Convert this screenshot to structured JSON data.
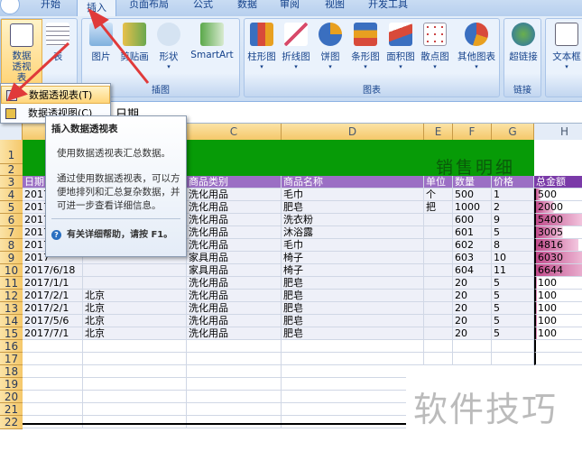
{
  "tabs": [
    "开始",
    "插入",
    "页面布局",
    "公式",
    "数据",
    "审阅",
    "视图",
    "开发工具"
  ],
  "ribbon": {
    "table_group": {
      "pivot": "数据透视表",
      "table": "表"
    },
    "illustrations": {
      "label": "插图",
      "buttons": [
        "图片",
        "剪贴画",
        "形状",
        "SmartArt"
      ]
    },
    "charts": {
      "label": "图表",
      "buttons": [
        "柱形图",
        "折线图",
        "饼图",
        "条形图",
        "面积图",
        "散点图",
        "其他图表"
      ]
    },
    "links": {
      "label": "链接",
      "buttons": [
        "超链接"
      ]
    },
    "text": {
      "buttons": [
        "文本框"
      ]
    }
  },
  "menu": {
    "items": [
      "数据透视表(T)",
      "数据透视图(C)"
    ]
  },
  "formula_bar": {
    "value": "日期"
  },
  "tooltip": {
    "title": "插入数据透视表",
    "line1": "使用数据透视表汇总数据。",
    "line2": "通过使用数据透视表，可以方便地排列和汇总复杂数据，并可进一步查看详细信息。",
    "help": "有关详细帮助，请按 F1。"
  },
  "columns": [
    "C",
    "D",
    "E",
    "F",
    "G",
    "H"
  ],
  "sheet": {
    "title": "销售明细",
    "headers": [
      "日期",
      "",
      "商品类别",
      "商品名称",
      "单位",
      "数量",
      "价格",
      "总金额"
    ],
    "rows": [
      [
        "2017",
        "",
        "洗化用品",
        "毛巾",
        "个",
        "500",
        "1",
        "500"
      ],
      [
        "2017",
        "",
        "洗化用品",
        "肥皂",
        "把",
        "1000",
        "2",
        "2000"
      ],
      [
        "2017",
        "",
        "洗化用品",
        "洗衣粉",
        "",
        "600",
        "9",
        "5400"
      ],
      [
        "2017",
        "",
        "洗化用品",
        "沐浴露",
        "",
        "601",
        "5",
        "3005"
      ],
      [
        "2017",
        "",
        "洗化用品",
        "毛巾",
        "",
        "602",
        "8",
        "4816"
      ],
      [
        "2017",
        "",
        "家具用品",
        "椅子",
        "",
        "603",
        "10",
        "6030"
      ],
      [
        "2017/6/18",
        "",
        "家具用品",
        "椅子",
        "",
        "604",
        "11",
        "6644"
      ],
      [
        "2017/1/1",
        "",
        "洗化用品",
        "肥皂",
        "",
        "20",
        "5",
        "100"
      ],
      [
        "2017/2/1",
        "北京",
        "洗化用品",
        "肥皂",
        "",
        "20",
        "5",
        "100"
      ],
      [
        "2017/2/1",
        "北京",
        "洗化用品",
        "肥皂",
        "",
        "20",
        "5",
        "100"
      ],
      [
        "2017/5/6",
        "北京",
        "洗化用品",
        "肥皂",
        "",
        "20",
        "5",
        "100"
      ],
      [
        "2017/7/1",
        "北京",
        "洗化用品",
        "肥皂",
        "",
        "20",
        "5",
        "100"
      ]
    ],
    "bar_max": 6644,
    "row_numbers": [
      "1",
      "2",
      "3",
      "4",
      "5",
      "6",
      "7",
      "8",
      "9",
      "10",
      "11",
      "12",
      "13",
      "14",
      "15",
      "16",
      "17",
      "18",
      "19",
      "20",
      "21",
      "22"
    ]
  },
  "watermark": "软件技巧",
  "colors": {
    "title_band": "#079b07",
    "header_band": "#9b6fc4",
    "bar": "#c04a8a",
    "arrow": "#e03a3a"
  }
}
